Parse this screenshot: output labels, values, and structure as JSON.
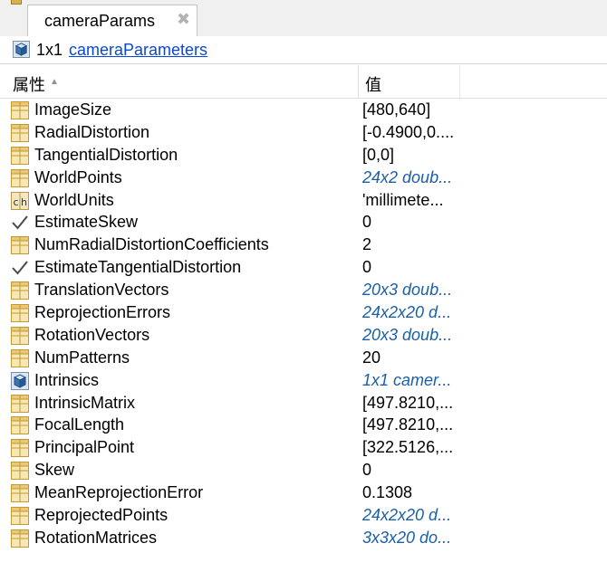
{
  "tab": {
    "label": "cameraParams",
    "close_glyph": "✖"
  },
  "info": {
    "size": "1x1",
    "class_name": "cameraParameters"
  },
  "table": {
    "col_property": "属性",
    "col_value": "值"
  },
  "rows": [
    {
      "name": "ImageSize",
      "value": "[480,640]",
      "icon": "matrix-icon",
      "link": false
    },
    {
      "name": "RadialDistortion",
      "value": "[-0.4900,0....",
      "icon": "matrix-icon",
      "link": false
    },
    {
      "name": "TangentialDistortion",
      "value": "[0,0]",
      "icon": "matrix-icon",
      "link": false
    },
    {
      "name": "WorldPoints",
      "value": "24x2 doub...",
      "icon": "matrix-icon",
      "link": true
    },
    {
      "name": "WorldUnits",
      "value": "'millimete...",
      "icon": "char-icon",
      "link": false
    },
    {
      "name": "EstimateSkew",
      "value": "0",
      "icon": "checkmark-icon",
      "link": false
    },
    {
      "name": "NumRadialDistortionCoefficients",
      "value": "2",
      "icon": "matrix-icon",
      "link": false
    },
    {
      "name": "EstimateTangentialDistortion",
      "value": "0",
      "icon": "checkmark-icon",
      "link": false
    },
    {
      "name": "TranslationVectors",
      "value": "20x3 doub...",
      "icon": "matrix-icon",
      "link": true
    },
    {
      "name": "ReprojectionErrors",
      "value": "24x2x20 d...",
      "icon": "matrix-icon",
      "link": true
    },
    {
      "name": "RotationVectors",
      "value": "20x3 doub...",
      "icon": "matrix-icon",
      "link": true
    },
    {
      "name": "NumPatterns",
      "value": "20",
      "icon": "matrix-icon",
      "link": false
    },
    {
      "name": "Intrinsics",
      "value": "1x1 camer...",
      "icon": "object-icon",
      "link": true
    },
    {
      "name": "IntrinsicMatrix",
      "value": "[497.8210,...",
      "icon": "matrix-icon",
      "link": false
    },
    {
      "name": "FocalLength",
      "value": "[497.8210,...",
      "icon": "matrix-icon",
      "link": false
    },
    {
      "name": "PrincipalPoint",
      "value": "[322.5126,...",
      "icon": "matrix-icon",
      "link": false
    },
    {
      "name": "Skew",
      "value": "0",
      "icon": "matrix-icon",
      "link": false
    },
    {
      "name": "MeanReprojectionError",
      "value": "0.1308",
      "icon": "matrix-icon",
      "link": false
    },
    {
      "name": "ReprojectedPoints",
      "value": "24x2x20 d...",
      "icon": "matrix-icon",
      "link": true
    },
    {
      "name": "RotationMatrices",
      "value": "3x3x20 do...",
      "icon": "matrix-icon",
      "link": true
    }
  ]
}
